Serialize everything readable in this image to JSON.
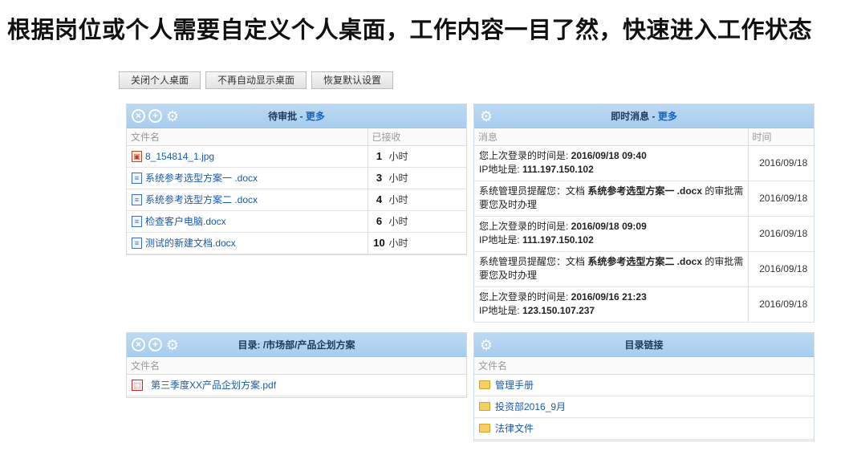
{
  "headline": "根据岗位或个人需要自定义个人桌面，工作内容一目了然，快速进入工作状态",
  "toolbar": {
    "close_label": "关闭个人桌面",
    "hide_label": "不再自动显示桌面",
    "reset_label": "恢复默认设置"
  },
  "pending": {
    "title": "待审批",
    "sep": " - ",
    "more": "更多",
    "col_name": "文件名",
    "col_received": "已接收",
    "rows": [
      {
        "icon": "image-file-icon",
        "name": "8_154814_1.jpg",
        "hours": "1",
        "unit": "小时"
      },
      {
        "icon": "word-doc-icon",
        "name": "系统参考选型方案一 .docx",
        "hours": "3",
        "unit": "小时"
      },
      {
        "icon": "word-doc-icon",
        "name": "系统参考选型方案二 .docx",
        "hours": "4",
        "unit": "小时"
      },
      {
        "icon": "word-doc-icon",
        "name": "检查客户电脑.docx",
        "hours": "6",
        "unit": "小时"
      },
      {
        "icon": "word-doc-icon",
        "name": "测试的新建文档.docx",
        "hours": "10",
        "unit": "小时"
      }
    ]
  },
  "messages": {
    "title": "即时消息",
    "sep": " - ",
    "more": "更多",
    "col_msg": "消息",
    "col_time": "时间",
    "rows": [
      {
        "l1a": "您上次登录的时间是: ",
        "l1b": "2016/09/18 09:40",
        "l1c": "",
        "l2a": "IP地址是: ",
        "l2b": "111.197.150.102",
        "time": "2016/09/18"
      },
      {
        "l1a": "系统管理员提醒您：文档 ",
        "l1b": "系统参考选型方案一 .docx",
        "l1c": " 的审批需",
        "l2a": "要您及时办理",
        "l2b": "",
        "time": "2016/09/18"
      },
      {
        "l1a": "您上次登录的时间是: ",
        "l1b": "2016/09/18 09:09",
        "l1c": "",
        "l2a": "IP地址是: ",
        "l2b": "111.197.150.102",
        "time": "2016/09/18"
      },
      {
        "l1a": "系统管理员提醒您：文档 ",
        "l1b": "系统参考选型方案二 .docx",
        "l1c": " 的审批需",
        "l2a": "要您及时办理",
        "l2b": "",
        "time": "2016/09/18"
      },
      {
        "l1a": "您上次登录的时间是: ",
        "l1b": "2016/09/16 21:23",
        "l1c": "",
        "l2a": "IP地址是: ",
        "l2b": "123.150.107.237",
        "time": "2016/09/18"
      }
    ]
  },
  "directory": {
    "title": "目录: /市场部/产品企划方案",
    "col_name": "文件名",
    "rows": [
      {
        "icon": "pdf-file-icon",
        "name": "第三季度XX产品企划方案.pdf"
      }
    ]
  },
  "links": {
    "title": "目录链接",
    "col_name": "文件名",
    "rows": [
      {
        "icon": "folder-icon",
        "name": "管理手册"
      },
      {
        "icon": "folder-icon",
        "name": "投资部2016_9月"
      },
      {
        "icon": "folder-icon",
        "name": "法律文件"
      }
    ]
  },
  "icons": {
    "close": "close-circle-icon",
    "add": "add-circle-icon",
    "settings": "gear-icon"
  },
  "colors": {
    "header_bg": "#a8cdee",
    "link": "#1a5aa6",
    "more_link": "#1565c0"
  }
}
